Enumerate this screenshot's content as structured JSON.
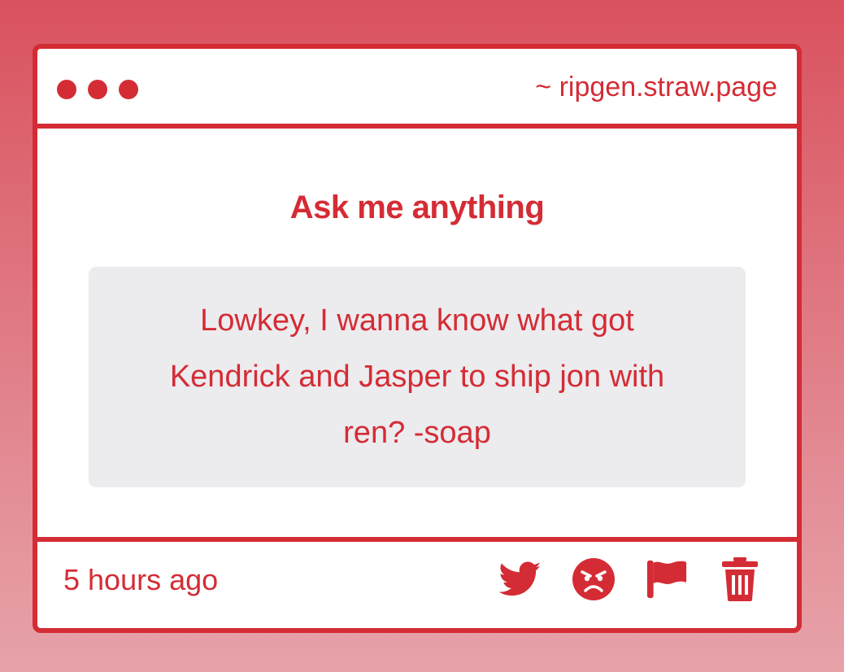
{
  "window": {
    "url": "~ ripgen.straw.page"
  },
  "main": {
    "heading": "Ask me anything",
    "question": "Lowkey, I wanna know what got Kendrick and Jasper to ship jon with ren? -soap"
  },
  "footer": {
    "timestamp": "5 hours ago",
    "actions": [
      {
        "icon": "twitter-icon"
      },
      {
        "icon": "angry-face-icon"
      },
      {
        "icon": "flag-icon"
      },
      {
        "icon": "trash-icon"
      }
    ]
  },
  "colors": {
    "accent": "#d42c35",
    "card_bg": "#ffffff",
    "question_bg": "#ecebee",
    "page_bg_top": "#d9525e",
    "page_bg_bottom": "#e7a2a9"
  }
}
